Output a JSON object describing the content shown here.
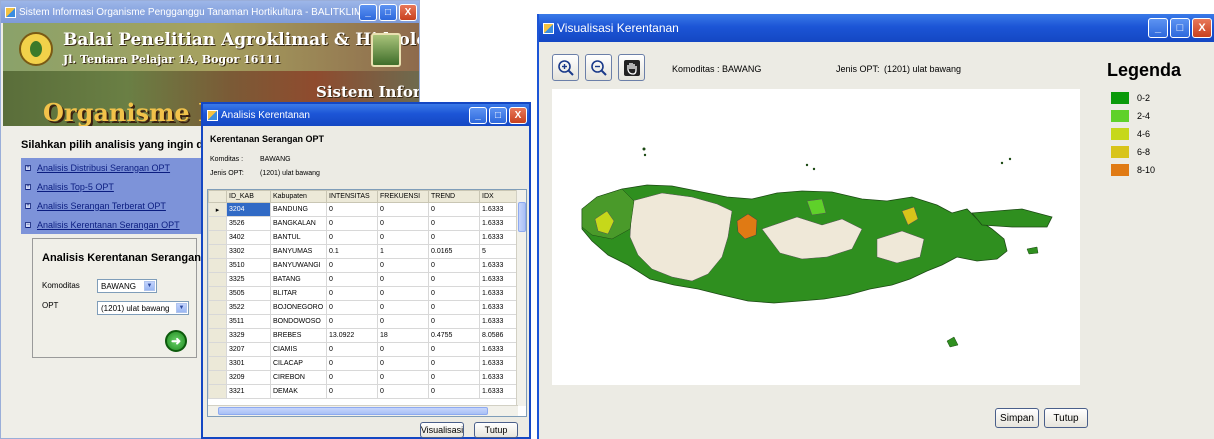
{
  "left_window": {
    "title": "Sistem Informasi Organisme Pengganggu Tanaman Hortikultura - BALITKLIMAT",
    "banner": {
      "org_name": "Balai Penelitian Agroklimat & Hidrologi",
      "address": "Jl. Tentara Pelajar 1A, Bogor 16111",
      "sistem": "Sistem Informasi",
      "headline": "Organisme Pengganggu Tanaman Hortikultura"
    },
    "lead": "Silahkan pilih analisis yang ingin dilakukan:",
    "menu": [
      {
        "label": "Analisis Distribusi Serangan OPT",
        "bullet": "+"
      },
      {
        "label": "Analisis Top-5 OPT",
        "bullet": "+"
      },
      {
        "label": "Analisis Serangan Terberat OPT",
        "bullet": "+"
      },
      {
        "label": "Analisis Kerentanan Serangan OPT",
        "bullet": "−"
      }
    ],
    "form": {
      "title": "Analisis Kerentanan Serangan OPT",
      "komoditas_label": "Komoditas",
      "komoditas_value": "BAWANG",
      "opt_label": "OPT",
      "opt_value": "(1201) ulat bawang"
    }
  },
  "mid_window": {
    "title": "Analisis Kerentanan",
    "heading": "Kerentanan Serangan OPT",
    "komoditas_label": "Komditas :",
    "komoditas_value": "BAWANG",
    "jenis_label": "Jenis OPT:",
    "jenis_value": "(1201) ulat bawang",
    "columns": [
      "ID_KAB",
      "Kabupaten",
      "INTENSITAS",
      "FREKUENSI",
      "TREND",
      "IDX"
    ],
    "rows": [
      [
        "3204",
        "BANDUNG",
        "0",
        "0",
        "0",
        "1.6333"
      ],
      [
        "3526",
        "BANGKALAN",
        "0",
        "0",
        "0",
        "1.6333"
      ],
      [
        "3402",
        "BANTUL",
        "0",
        "0",
        "0",
        "1.6333"
      ],
      [
        "3302",
        "BANYUMAS",
        "0.1",
        "1",
        "0.0165",
        "5"
      ],
      [
        "3510",
        "BANYUWANGI",
        "0",
        "0",
        "0",
        "1.6333"
      ],
      [
        "3325",
        "BATANG",
        "0",
        "0",
        "0",
        "1.6333"
      ],
      [
        "3505",
        "BLITAR",
        "0",
        "0",
        "0",
        "1.6333"
      ],
      [
        "3522",
        "BOJONEGORO",
        "0",
        "0",
        "0",
        "1.6333"
      ],
      [
        "3511",
        "BONDOWOSO",
        "0",
        "0",
        "0",
        "1.6333"
      ],
      [
        "3329",
        "BREBES",
        "13.0922",
        "18",
        "0.4755",
        "8.0586"
      ],
      [
        "3207",
        "CIAMIS",
        "0",
        "0",
        "0",
        "1.6333"
      ],
      [
        "3301",
        "CILACAP",
        "0",
        "0",
        "0",
        "1.6333"
      ],
      [
        "3209",
        "CIREBON",
        "0",
        "0",
        "0",
        "1.6333"
      ],
      [
        "3321",
        "DEMAK",
        "0",
        "0",
        "0",
        "1.6333"
      ]
    ],
    "btn_visualisasi": "Visualisasi",
    "btn_tutup": "Tutup"
  },
  "right_window": {
    "title": "Visualisasi Kerentanan",
    "zoom_in_icon": "zoom-in-icon",
    "zoom_out_icon": "zoom-out-icon",
    "pan_icon": "hand-icon",
    "komoditas_label": "Komoditas :",
    "komoditas_value": "BAWANG",
    "jenis_label": "Jenis OPT:",
    "jenis_value": "(1201) ulat bawang",
    "legend_title": "Legenda",
    "legend": [
      {
        "label": "0-2",
        "color": "#0a9a0a"
      },
      {
        "label": "2-4",
        "color": "#5fd12a"
      },
      {
        "label": "4-6",
        "color": "#c6d81a"
      },
      {
        "label": "6-8",
        "color": "#d8c41a"
      },
      {
        "label": "8-10",
        "color": "#e07a14"
      }
    ],
    "btn_simpan": "Simpan",
    "btn_tutup": "Tutup"
  }
}
